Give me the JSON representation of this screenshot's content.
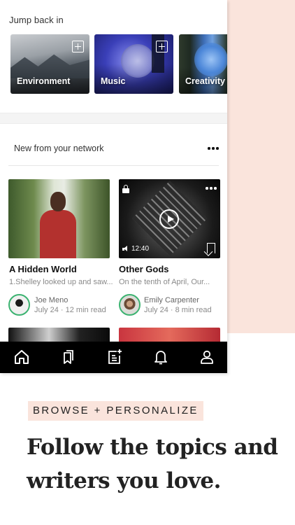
{
  "jump_back": {
    "heading": "Jump back in",
    "topics": [
      {
        "name": "Environment"
      },
      {
        "name": "Music"
      },
      {
        "name": "Creativity"
      }
    ]
  },
  "network": {
    "heading": "New from your network",
    "posts": [
      {
        "title": "A Hidden World",
        "snippet": "1.Shelley looked up and saw...",
        "author": "Joe Meno",
        "meta": "July 24 · 12 min read"
      },
      {
        "title": "Other Gods",
        "snippet": "On the tenth of April, Our...",
        "author": "Emily Carpenter",
        "meta": "July 24 · 8 min read",
        "audio_duration": "12:40"
      }
    ]
  },
  "tabbar": {
    "tabs": [
      {
        "icon": "home-icon"
      },
      {
        "icon": "bookmarks-icon"
      },
      {
        "icon": "new-story-icon"
      },
      {
        "icon": "notifications-icon"
      },
      {
        "icon": "profile-icon"
      }
    ]
  },
  "promo": {
    "tag": "BROWSE + PERSONALIZE",
    "headline": "Follow the topics and writers you love."
  },
  "colors": {
    "accent_peach": "#fae4dc",
    "tabbar": "#000000",
    "avatar_ring": "#3cb371"
  }
}
